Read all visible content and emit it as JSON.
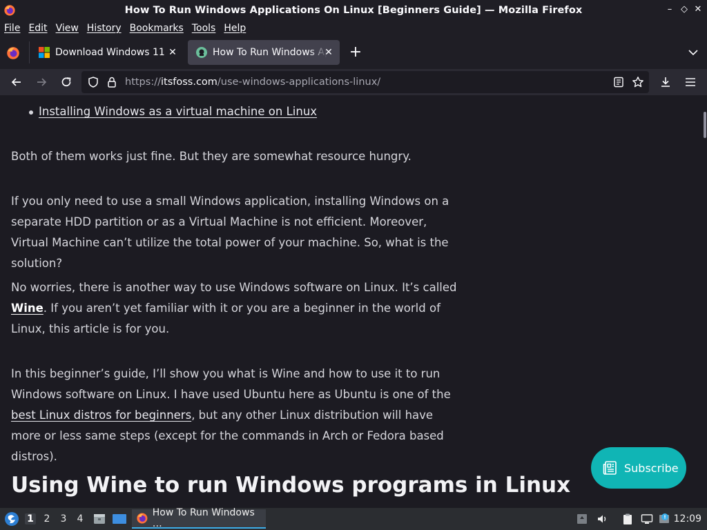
{
  "window": {
    "title": "How To Run Windows Applications On Linux [Beginners Guide] — Mozilla Firefox"
  },
  "menubar": {
    "items": [
      "File",
      "Edit",
      "View",
      "History",
      "Bookmarks",
      "Tools",
      "Help"
    ]
  },
  "tabs": [
    {
      "label": "Download Windows 11",
      "active": false
    },
    {
      "label": "How To Run Windows Applications On Linux",
      "active": true
    }
  ],
  "navbar": {
    "url_scheme": "https://",
    "url_host": "itsfoss.com",
    "url_path": "/use-windows-applications-linux/"
  },
  "article": {
    "bullet_link": "Installing Windows as a virtual machine on Linux",
    "p1": "Both of them works just fine. But they are somewhat resource hungry.",
    "p2": "If you only need to use a small Windows application, installing Windows on a separate HDD partition or as a Virtual Machine is not efficient. Moreover, Virtual Machine can’t utilize the total power of your machine. So, what is the solution?",
    "p3_before": "No worries, there is another way to use Windows software on Linux. It’s called ",
    "p3_link": "Wine",
    "p3_after": ". If you aren’t yet familiar with it or you are a beginner in the world of Linux, this article is for you.",
    "p4_before": "In this beginner’s guide, I’ll show you what is Wine and how to use it to run Windows software on Linux. I have used Ubuntu here as Ubuntu is one of the ",
    "p4_link": "best Linux distros for beginners",
    "p4_after": ", but any other Linux distribution will have more or less same steps (except for the commands in Arch or Fedora based distros).",
    "heading": "Using Wine to run Windows programs in Linux"
  },
  "subscribe": {
    "label": "Subscribe"
  },
  "taskbar": {
    "workspaces": [
      "1",
      "2",
      "3",
      "4"
    ],
    "active_workspace": "1",
    "task_label": "How To Run Windows …",
    "clock": "12:09"
  },
  "colors": {
    "accent_subscribe": "#10b5b5",
    "content_bg": "#1c1b22",
    "active_task_underline": "#3daee9"
  }
}
